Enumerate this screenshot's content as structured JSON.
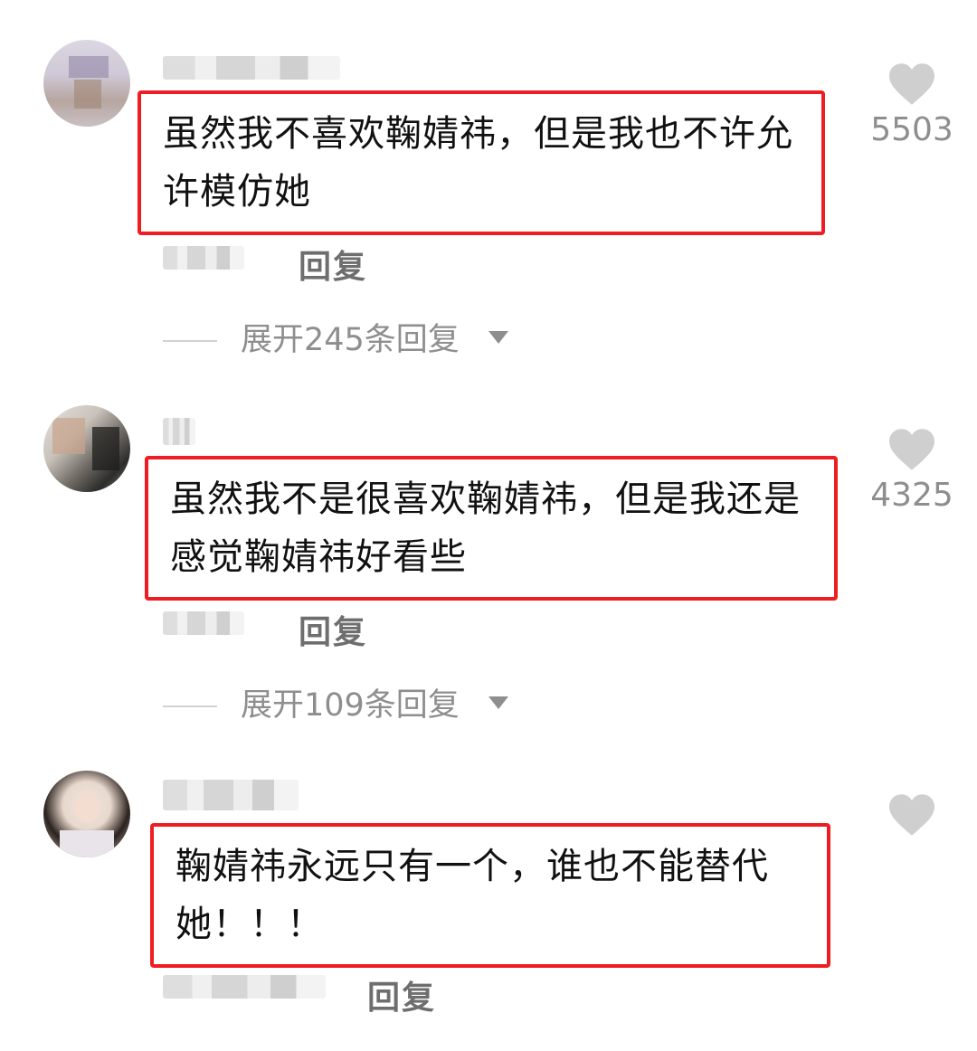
{
  "comments": [
    {
      "text": "虽然我不喜欢鞠婧祎，但是我也不许允许模仿她",
      "likes": "5503",
      "reply_label": "回复",
      "expand_label": "展开245条回复"
    },
    {
      "text": "虽然我不是很喜欢鞠婧祎，但是我还是感觉鞠婧祎好看些",
      "likes": "4325",
      "reply_label": "回复",
      "expand_label": "展开109条回复"
    },
    {
      "text": "鞠婧祎永远只有一个，谁也不能替代她！！！",
      "likes": "",
      "reply_label": "回复"
    }
  ],
  "colors": {
    "highlight_border": "#ee1d23",
    "muted_text": "#8e8e8e",
    "heart": "#cfcfcf"
  },
  "icons": {
    "like": "heart-icon",
    "expand": "caret-down-icon"
  }
}
